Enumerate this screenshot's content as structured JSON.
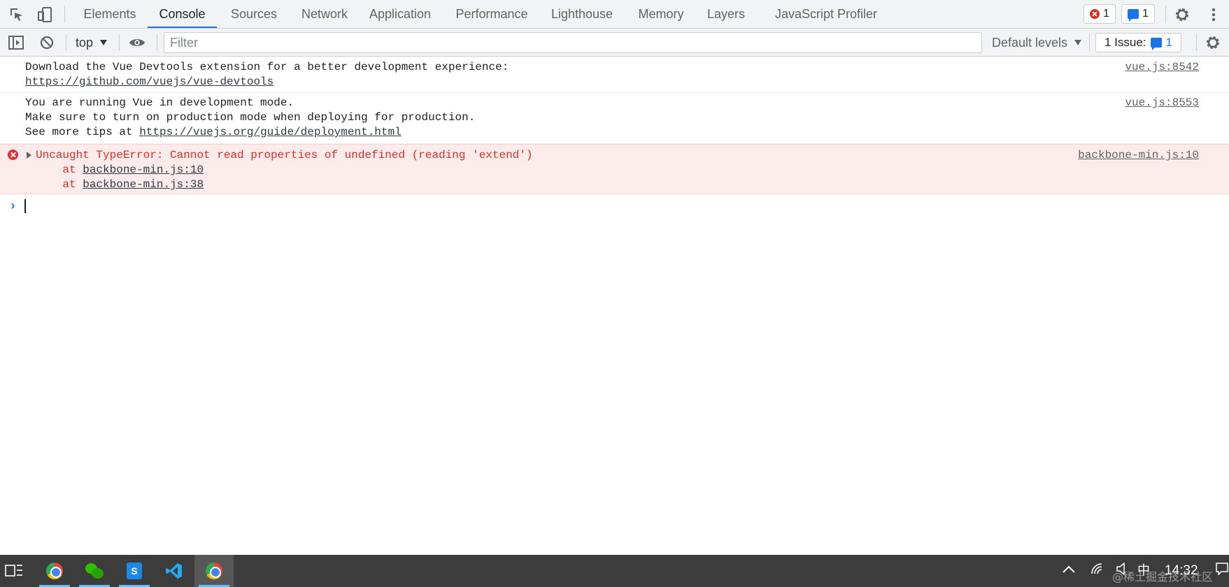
{
  "tabs": [
    {
      "label": "Elements"
    },
    {
      "label": "Console"
    },
    {
      "label": "Sources"
    },
    {
      "label": "Network"
    },
    {
      "label": "Application"
    },
    {
      "label": "Performance"
    },
    {
      "label": "Lighthouse"
    },
    {
      "label": "Memory"
    },
    {
      "label": "Layers"
    },
    {
      "label": "JavaScript Profiler"
    }
  ],
  "active_tab": "Console",
  "error_count": "1",
  "message_count": "1",
  "toolbar": {
    "context": "top",
    "filter_placeholder": "Filter",
    "levels": "Default levels",
    "issues_label": "1 Issue:",
    "issues_count": "1"
  },
  "messages": [
    {
      "type": "log",
      "lines": [
        "Download the Vue Devtools extension for a better development experience:"
      ],
      "link": "https://github.com/vuejs/vue-devtools",
      "source": "vue.js:8542"
    },
    {
      "type": "log",
      "lines": [
        "You are running Vue in development mode.",
        "Make sure to turn on production mode when deploying for production.",
        "See more tips at "
      ],
      "link": "https://vuejs.org/guide/deployment.html",
      "source": "vue.js:8553"
    },
    {
      "type": "error",
      "text": "Uncaught TypeError: Cannot read properties of undefined (reading 'extend')",
      "stack_prefix": "    at ",
      "stack": [
        "backbone-min.js:10",
        "backbone-min.js:38"
      ],
      "source": "backbone-min.js:10"
    }
  ],
  "taskbar": {
    "ime": "中",
    "time": "14:32",
    "watermark": "@稀土掘金技术社区"
  }
}
